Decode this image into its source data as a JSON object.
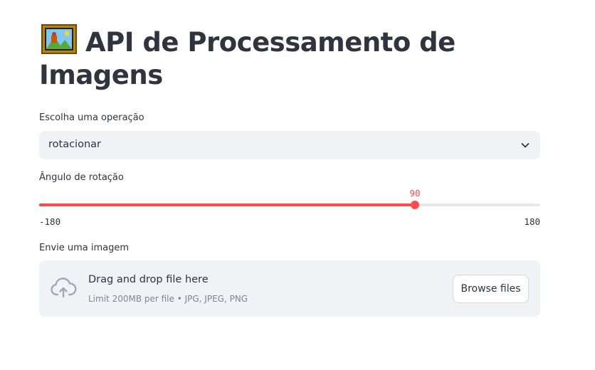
{
  "page": {
    "title": "API de Processamento de Imagens",
    "title_icon": "framed-picture-icon"
  },
  "operation": {
    "label": "Escolha uma operação",
    "selected": "rotacionar",
    "icon": "chevron-down-icon"
  },
  "rotation": {
    "label": "Ângulo de rotação",
    "value": 90,
    "value_text": "90",
    "min": -180,
    "max": 180,
    "min_text": "-180",
    "max_text": "180",
    "accent_color": "#ff4b4b"
  },
  "upload": {
    "label": "Envie uma imagem",
    "drop_text": "Drag and drop file here",
    "limit_text": "Limit 200MB per file • JPG, JPEG, PNG",
    "button_label": "Browse files",
    "icon": "cloud-upload-icon"
  }
}
